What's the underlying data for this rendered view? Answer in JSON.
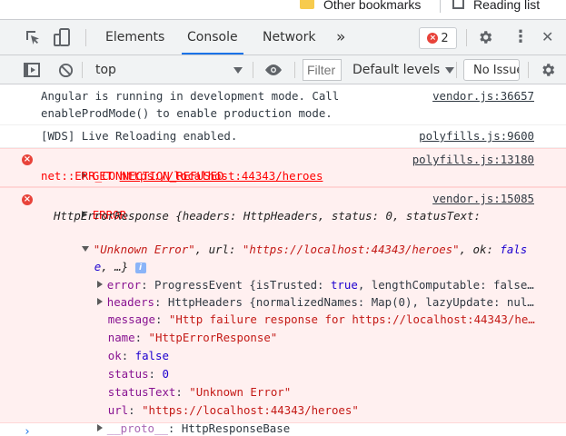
{
  "bookmarks": {
    "other_label": "Other bookmarks",
    "reading_label": "Reading list"
  },
  "toolbar": {
    "tabs": [
      "Elements",
      "Console",
      "Network"
    ],
    "more_tabs": "»",
    "error_count": "2",
    "close": "✕",
    "menu": "⋮"
  },
  "filterbar": {
    "context": "top",
    "filter_placeholder": "Filter",
    "levels_label": "Default levels",
    "issues_label": "No Issues"
  },
  "console": {
    "msg1": {
      "line1": "Angular is running in development mode. Call",
      "line2": "enableProdMode() to enable production mode.",
      "source": "vendor.js:36657"
    },
    "msg2": {
      "text": "[WDS] Live Reloading enabled.",
      "source": "polyfills.js:9600"
    },
    "msg3": {
      "method": "GET",
      "url": "https://localhost:44343/heroes",
      "error": "net::ERR_CONNECTION_REFUSED",
      "source": "polyfills.js:13180"
    },
    "msg4": {
      "label": "ERROR",
      "source": "vendor.js:15085",
      "summary1": "HttpErrorResponse {headers: HttpHeaders, status: 0, statusText:",
      "summary2_str": "\"Unknown Error\"",
      "summary2_rest_a": ", url: ",
      "summary2_url": "\"https://localhost:44343/heroes\"",
      "summary2_rest_b": ", ok: ",
      "summary2_ok": "fals",
      "summary3_ok": "e",
      "summary3_rest": ", …}",
      "info_badge": "i",
      "props": {
        "error_key": "error",
        "error_val": "ProgressEvent {isTrusted: ",
        "error_true": "true",
        "error_tail": ", lengthComputable: false…",
        "headers_key": "headers",
        "headers_val": "HttpHeaders {normalizedNames: Map(0), lazyUpdate: nul…",
        "message_key": "message",
        "message_val": "\"Http failure response for https://localhost:44343/he…",
        "name_key": "name",
        "name_val": "\"HttpErrorResponse\"",
        "ok_key": "ok",
        "ok_val": "false",
        "status_key": "status",
        "status_val": "0",
        "statusText_key": "statusText",
        "statusText_val": "\"Unknown Error\"",
        "url_key": "url",
        "url_val": "\"https://localhost:44343/heroes\"",
        "proto_key": "__proto__",
        "proto_val": "HttpResponseBase"
      }
    },
    "prompt": "›"
  },
  "colors": {
    "accent": "#1a73e8",
    "error_bg": "#fff0f0",
    "error_text": "#ff0000",
    "string": "#c41a16",
    "key": "#881391"
  }
}
